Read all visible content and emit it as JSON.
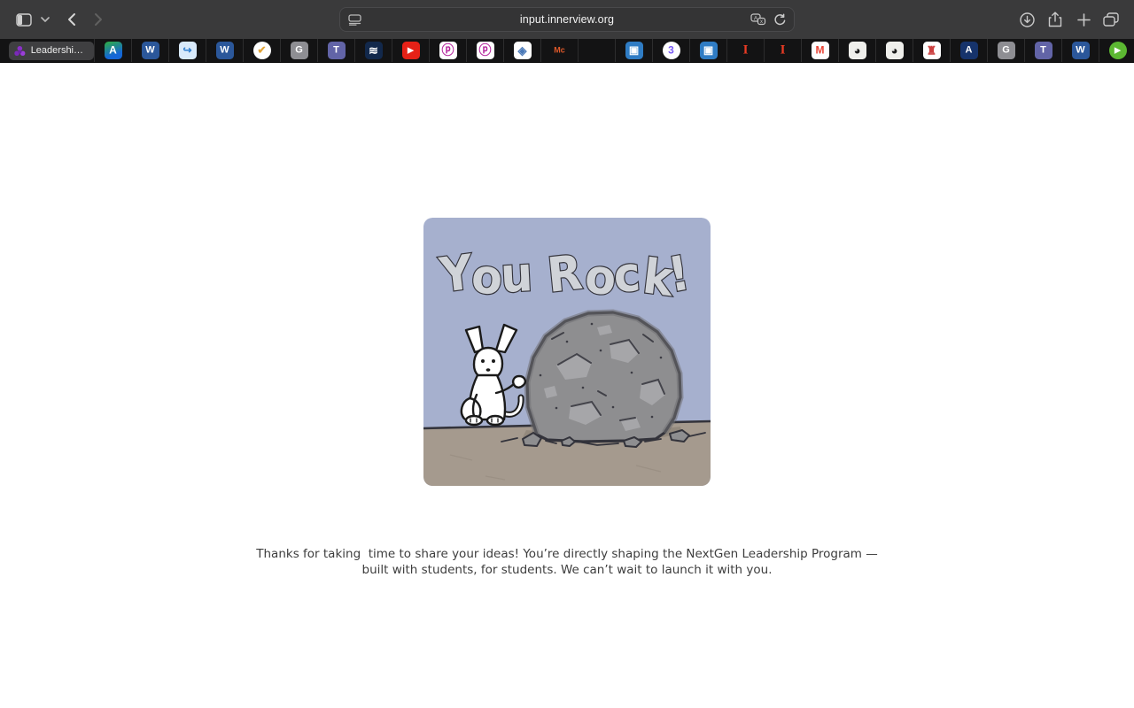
{
  "browser": {
    "toolbar": {
      "url": "input.innerview.org",
      "icons": [
        "sidebar",
        "tab-group-chevron",
        "back",
        "forward",
        "reader",
        "translate",
        "reload",
        "download",
        "share",
        "new-tab",
        "tab-overview"
      ]
    },
    "active_tab_label": "Leadership...",
    "accent_colors": {
      "toolbar_bg": "#3a3a3b",
      "tabbar_bg": "#131314",
      "field_bg": "#343435"
    },
    "pinned_tabs": [
      {
        "name": "classlink",
        "bg": "linear-gradient(160deg,#2fae3f 0%,#1467d6 70%)",
        "fg": "#ffffff",
        "glyph": "A",
        "size": 12
      },
      {
        "name": "word-1",
        "bg": "#2b579a",
        "fg": "#ffffff",
        "glyph": "W",
        "size": 11
      },
      {
        "name": "ehallpass",
        "bg": "#d9eafb",
        "fg": "#2f7fd0",
        "glyph": "↪",
        "size": 12
      },
      {
        "name": "word-2",
        "bg": "#2b579a",
        "fg": "#ffffff",
        "glyph": "W",
        "size": 11
      },
      {
        "name": "check-badge",
        "bg": "#ffffff",
        "fg": "#e2a437",
        "glyph": "✔",
        "size": 12,
        "round": true
      },
      {
        "name": "g-app-1",
        "bg": "#8e8e93",
        "fg": "#ffffff",
        "glyph": "G",
        "size": 11
      },
      {
        "name": "teams-1",
        "bg": "#6264a7",
        "fg": "#ffffff",
        "glyph": "T",
        "size": 11
      },
      {
        "name": "kami",
        "bg": "#12284b",
        "fg": "#ffffff",
        "glyph": "≋",
        "size": 13
      },
      {
        "name": "youtube",
        "bg": "#e62117",
        "fg": "#ffffff",
        "glyph": "▶",
        "size": 9
      },
      {
        "name": "prodigy-1",
        "bg": "#ffffff",
        "fg": "#b5289e",
        "glyph": "ⓟ",
        "size": 14
      },
      {
        "name": "prodigy-2",
        "bg": "#ffffff",
        "fg": "#b5289e",
        "glyph": "ⓟ",
        "size": 14
      },
      {
        "name": "shield-crest",
        "bg": "#ffffff",
        "fg": "#4a79b8",
        "glyph": "◈",
        "size": 13
      },
      {
        "name": "mcgraw",
        "bg": "transparent",
        "fg": "#e0592a",
        "glyph": "Mc",
        "size": 9
      },
      {
        "name": "microsoft",
        "bg": "transparent",
        "grid": [
          "#f25022",
          "#7fba00",
          "#00a4ef",
          "#ffb900"
        ]
      },
      {
        "name": "pip-blue-1",
        "bg": "#2f7cc4",
        "fg": "#ffffff",
        "glyph": "▣",
        "size": 12
      },
      {
        "name": "circled-3",
        "bg": "#ffffff",
        "fg": "#7a5af5",
        "glyph": "3",
        "size": 12,
        "round": true
      },
      {
        "name": "pip-blue-2",
        "bg": "#2f7cc4",
        "fg": "#ffffff",
        "glyph": "▣",
        "size": 12
      },
      {
        "name": "illinois-1",
        "bg": "transparent",
        "fg": "#ea3b24",
        "glyph": "I",
        "size": 15,
        "serif": true
      },
      {
        "name": "illinois-2",
        "bg": "transparent",
        "fg": "#ea3b24",
        "glyph": "I",
        "size": 15,
        "serif": true
      },
      {
        "name": "gmail",
        "bg": "#ffffff",
        "fg": "#ea4335",
        "glyph": "M",
        "size": 12
      },
      {
        "name": "dark-orb-1",
        "bg": "#efefec",
        "fg": "#1b1b1b",
        "glyph": "◕",
        "size": 13
      },
      {
        "name": "dark-orb-2",
        "bg": "#efefec",
        "fg": "#1b1b1b",
        "glyph": "◕",
        "size": 13
      },
      {
        "name": "castle-crest",
        "bg": "#ffffff",
        "fg": "#cc4040",
        "glyph": "♜",
        "size": 13
      },
      {
        "name": "a-shield",
        "bg": "#16336b",
        "fg": "#ffffff",
        "glyph": "A",
        "size": 11
      },
      {
        "name": "g-app-2",
        "bg": "#8e8e93",
        "fg": "#ffffff",
        "glyph": "G",
        "size": 11
      },
      {
        "name": "teams-2",
        "bg": "#6264a7",
        "fg": "#ffffff",
        "glyph": "T",
        "size": 11
      },
      {
        "name": "word-3",
        "bg": "#2b579a",
        "fg": "#ffffff",
        "glyph": "W",
        "size": 11
      },
      {
        "name": "green-play",
        "bg": "#5cb832",
        "fg": "#ffffff",
        "glyph": "▶",
        "size": 9,
        "round": true
      }
    ]
  },
  "page": {
    "comic_title": "You Rock!",
    "comic_colors": {
      "sky": "#a6b0ce",
      "ground": "#a59a8e",
      "ground-shadow": "#8f8479",
      "rock": "#8e8e90",
      "rock-edge": "#6f6f73",
      "rock-patch": "#a6a6a9",
      "outline": "#33333b",
      "letters": "#d0d3d8",
      "dog": "#ffffff",
      "dog-line": "#1a1a1a"
    },
    "caption": "Thanks for taking  time to share your ideas! You’re directly shaping the NextGen Leadership Program — built with students, for students. We can’t wait to launch it with you."
  }
}
